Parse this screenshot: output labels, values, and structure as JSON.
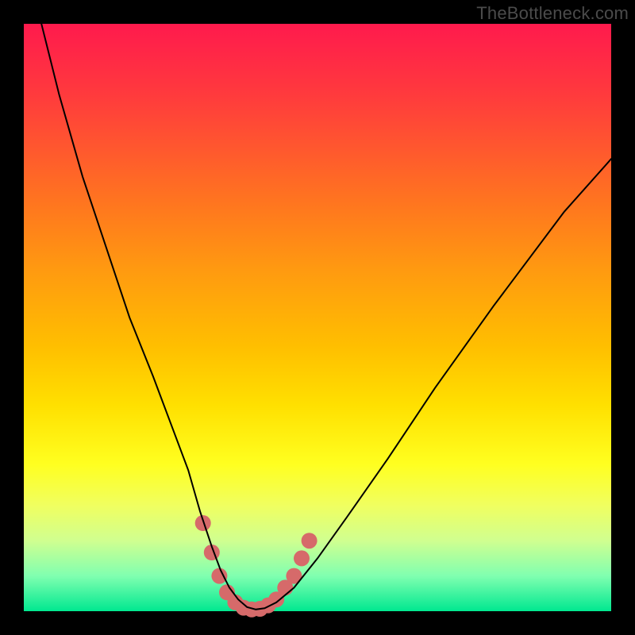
{
  "watermark": "TheBottleneck.com",
  "chart_data": {
    "type": "line",
    "title": "",
    "xlabel": "",
    "ylabel": "",
    "xlim": [
      0,
      100
    ],
    "ylim": [
      0,
      100
    ],
    "series": [
      {
        "name": "bottleneck-curve",
        "x": [
          3,
          6,
          10,
          14,
          18,
          22,
          25,
          28,
          30,
          32,
          33.5,
          35,
          36.5,
          38,
          39.5,
          41,
          43,
          46,
          50,
          55,
          62,
          70,
          80,
          92,
          100
        ],
        "y": [
          100,
          88,
          74,
          62,
          50,
          40,
          32,
          24,
          17,
          11,
          7,
          4,
          2,
          0.7,
          0.3,
          0.5,
          1.5,
          4,
          9,
          16,
          26,
          38,
          52,
          68,
          77
        ],
        "color": "#000000",
        "width": 2
      }
    ],
    "markers": {
      "name": "trough-markers",
      "color": "#d66a6a",
      "radius": 10,
      "points": [
        {
          "x": 30.5,
          "y": 15
        },
        {
          "x": 32,
          "y": 10
        },
        {
          "x": 33.3,
          "y": 6
        },
        {
          "x": 34.6,
          "y": 3.2
        },
        {
          "x": 36,
          "y": 1.5
        },
        {
          "x": 37.4,
          "y": 0.6
        },
        {
          "x": 38.8,
          "y": 0.3
        },
        {
          "x": 40.2,
          "y": 0.4
        },
        {
          "x": 41.6,
          "y": 1
        },
        {
          "x": 43,
          "y": 2
        },
        {
          "x": 44.5,
          "y": 4
        },
        {
          "x": 46,
          "y": 6
        },
        {
          "x": 47.3,
          "y": 9
        },
        {
          "x": 48.6,
          "y": 12
        }
      ]
    }
  }
}
